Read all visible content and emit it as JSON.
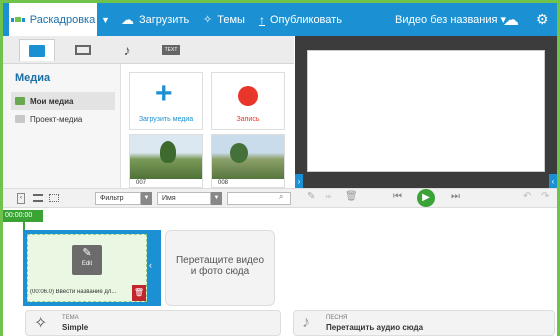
{
  "header": {
    "storyboard_label": "Раскадровка",
    "upload_label": "Загрузить",
    "themes_label": "Темы",
    "publish_label": "Опубликовать",
    "video_title": "Видео без названия ▾"
  },
  "tabs": {
    "text_tab_label": "TEXT"
  },
  "sidebar": {
    "title": "Медиа",
    "items": [
      {
        "label": "Мои медиа"
      },
      {
        "label": "Проект-медиа"
      }
    ]
  },
  "media": {
    "upload_tile_label": "Загрузить медиа",
    "record_tile_label": "Запись",
    "thumb1_counter": "007",
    "thumb2_counter": "008"
  },
  "toolbar": {
    "filter_label": "Фильтр",
    "sort_label": "Имя",
    "search_placeholder": ""
  },
  "timeline": {
    "timecode": "00:00:00",
    "clip_edit_label": "Edit",
    "clip_caption": "(00:06.0) Ввести название дл...",
    "drop_text_line1": "Перетащите видео",
    "drop_text_line2": "и фото сюда",
    "theme_caption": "ТЕМА",
    "theme_value": "Simple",
    "song_caption": "ПЕСНЯ",
    "song_value": "Перетащить аудио сюда"
  },
  "colors": {
    "accent": "#1b91d3",
    "highlight_border": "#6fc24a",
    "record": "#e8372a",
    "play": "#3aa335"
  }
}
